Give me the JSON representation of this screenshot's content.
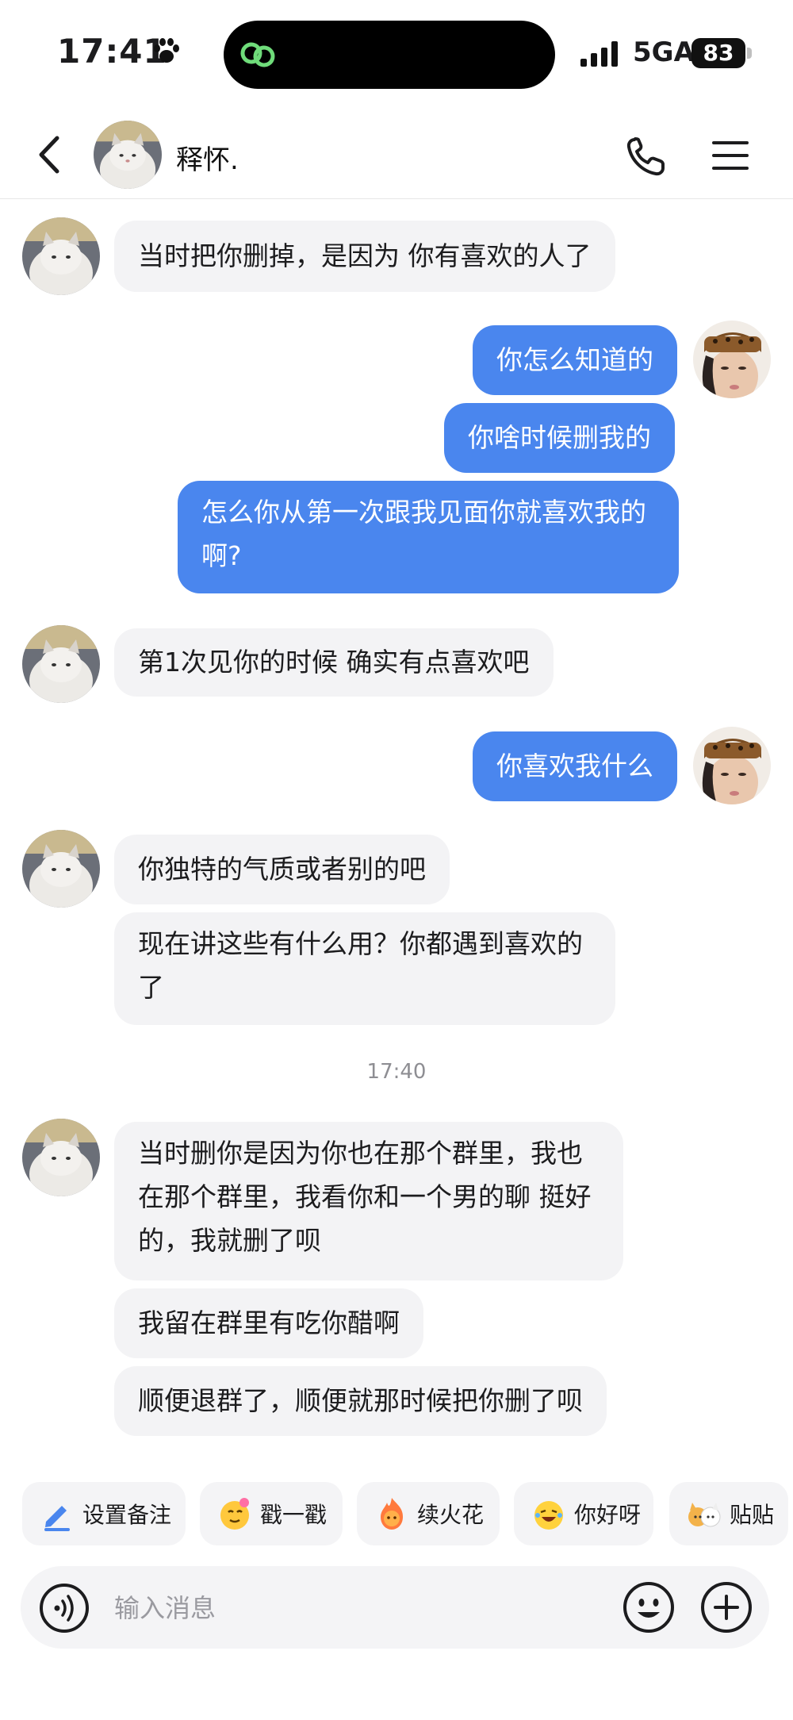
{
  "status_bar": {
    "time": "17:41",
    "network": "5GA",
    "battery": "83"
  },
  "header": {
    "contact_name": "释怀.",
    "icons": [
      "back-icon",
      "phone-icon",
      "menu-icon"
    ]
  },
  "messages": [
    {
      "from": "them",
      "text": "当时把你删掉，是因为  你有喜欢的人了"
    },
    {
      "from": "me",
      "text": "你怎么知道的"
    },
    {
      "from": "me",
      "text": "你啥时候删我的"
    },
    {
      "from": "me",
      "text": "怎么你从第一次跟我见面你就喜欢我的啊?"
    },
    {
      "from": "them",
      "text": "第1次见你的时候 确实有点喜欢吧"
    },
    {
      "from": "me",
      "text": "你喜欢我什么"
    },
    {
      "from": "them",
      "text": "你独特的气质或者别的吧"
    },
    {
      "from": "them",
      "text": "现在讲这些有什么用？你都遇到喜欢的了"
    },
    {
      "from": "them",
      "text": "当时删你是因为你也在那个群里，我也在那个群里，我看你和一个男的聊 挺好的，我就删了呗"
    },
    {
      "from": "them",
      "text": "我留在群里有吃你醋啊"
    },
    {
      "from": "them",
      "text": "顺便退群了，顺便就那时候把你删了呗"
    }
  ],
  "timestamp": "17:40",
  "quick_actions": [
    {
      "label": "设置备注",
      "icon": "pencil-icon"
    },
    {
      "label": "戳一戳",
      "icon": "poke-emoji-icon"
    },
    {
      "label": "续火花",
      "icon": "fire-emoji-icon"
    },
    {
      "label": "你好呀",
      "icon": "laugh-emoji-icon"
    },
    {
      "label": "贴贴",
      "icon": "cats-emoji-icon"
    }
  ],
  "input": {
    "placeholder": "输入消息"
  },
  "colors": {
    "outgoing_bubble": "#4a86ee",
    "incoming_bubble": "#f3f3f5",
    "accent": "#4a86ee"
  }
}
